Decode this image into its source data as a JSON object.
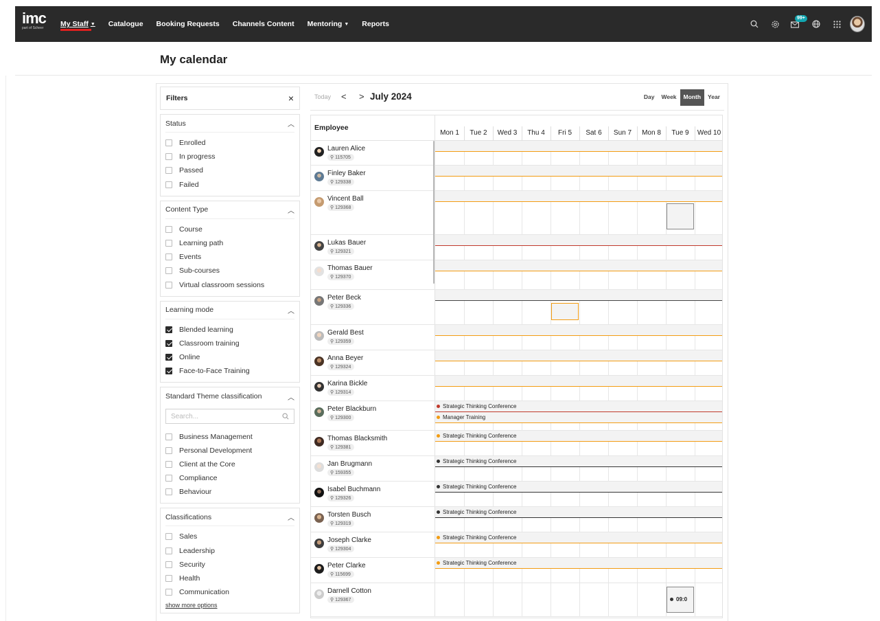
{
  "header": {
    "logo_text": "imc",
    "logo_sub": "part of Scheer",
    "nav": [
      {
        "label": "My Staff",
        "caret": true,
        "active": true
      },
      {
        "label": "Catalogue",
        "caret": false
      },
      {
        "label": "Booking Requests",
        "caret": false
      },
      {
        "label": "Channels Content",
        "caret": false
      },
      {
        "label": "Mentoring",
        "caret": true
      },
      {
        "label": "Reports",
        "caret": false
      }
    ],
    "badge": "99+"
  },
  "page": {
    "title": "My calendar"
  },
  "filters": {
    "title": "Filters",
    "close_glyph": "×",
    "status": {
      "title": "Status",
      "options": [
        {
          "label": "Enrolled",
          "checked": false
        },
        {
          "label": "In progress",
          "checked": false
        },
        {
          "label": "Passed",
          "checked": false
        },
        {
          "label": "Failed",
          "checked": false
        }
      ]
    },
    "content_type": {
      "title": "Content Type",
      "options": [
        {
          "label": "Course",
          "checked": false
        },
        {
          "label": "Learning path",
          "checked": false
        },
        {
          "label": "Events",
          "checked": false
        },
        {
          "label": "Sub-courses",
          "checked": false
        },
        {
          "label": "Virtual classroom sessions",
          "checked": false
        }
      ]
    },
    "learning_mode": {
      "title": "Learning mode",
      "options": [
        {
          "label": "Blended learning",
          "checked": true
        },
        {
          "label": "Classroom training",
          "checked": true
        },
        {
          "label": "Online",
          "checked": true
        },
        {
          "label": "Face-to-Face Training",
          "checked": true
        }
      ]
    },
    "theme": {
      "title": "Standard Theme classification",
      "search_placeholder": "Search...",
      "options": [
        {
          "label": "Business Management",
          "checked": false
        },
        {
          "label": "Personal Development",
          "checked": false
        },
        {
          "label": "Client at the Core",
          "checked": false
        },
        {
          "label": "Compliance",
          "checked": false
        },
        {
          "label": "Behaviour",
          "checked": false
        }
      ]
    },
    "classifications": {
      "title": "Classifications",
      "options": [
        {
          "label": "Sales",
          "checked": false
        },
        {
          "label": "Leadership",
          "checked": false
        },
        {
          "label": "Security",
          "checked": false
        },
        {
          "label": "Health",
          "checked": false
        },
        {
          "label": "Communication",
          "checked": false
        }
      ]
    },
    "show_more": "show more options"
  },
  "calendar": {
    "today": "Today",
    "prev": "<",
    "next": ">",
    "month_label": "July 2024",
    "views": [
      {
        "label": "Day"
      },
      {
        "label": "Week"
      },
      {
        "label": "Month",
        "selected": true
      },
      {
        "label": "Year"
      }
    ],
    "employee_header": "Employee",
    "days": [
      "Mon 1",
      "Tue 2",
      "Wed 3",
      "Thu 4",
      "Fri 5",
      "Sat 6",
      "Sun 7",
      "Mon 8",
      "Tue 9",
      "Wed 10"
    ],
    "colors": {
      "orange": "#f39c12",
      "red": "#c0392b",
      "dark": "#333333"
    },
    "employees": [
      {
        "name": "Lauren Alice",
        "id": "115705"
      },
      {
        "name": "Finley Baker",
        "id": "129338"
      },
      {
        "name": "Vincent Ball",
        "id": "129368"
      },
      {
        "name": "Lukas Bauer",
        "id": "129321"
      },
      {
        "name": "Thomas Bauer",
        "id": "129370"
      },
      {
        "name": "Peter Beck",
        "id": "129336"
      },
      {
        "name": "Gerald Best",
        "id": "129359"
      },
      {
        "name": "Anna Beyer",
        "id": "129324"
      },
      {
        "name": "Karina Bickle",
        "id": "129314"
      },
      {
        "name": "Peter Blackburn",
        "id": "129300",
        "events": [
          {
            "label": "Strategic Thinking Conference",
            "color": "#c0392b"
          },
          {
            "label": "Manager Training",
            "color": "#f39c12"
          }
        ]
      },
      {
        "name": "Thomas Blacksmith",
        "id": "129381",
        "events": [
          {
            "label": "Strategic Thinking Conference",
            "color": "#f39c12"
          }
        ]
      },
      {
        "name": "Jan Brugmann",
        "id": "159355",
        "events": [
          {
            "label": "Strategic Thinking Conference",
            "color": "#333333"
          }
        ]
      },
      {
        "name": "Isabel Buchmann",
        "id": "129326",
        "events": [
          {
            "label": "Strategic Thinking Conference",
            "color": "#333333"
          }
        ]
      },
      {
        "name": "Torsten Busch",
        "id": "129319",
        "events": [
          {
            "label": "Strategic Thinking Conference",
            "color": "#333333"
          }
        ]
      },
      {
        "name": "Joseph Clarke",
        "id": "129304",
        "events": [
          {
            "label": "Strategic Thinking Conference",
            "color": "#f39c12"
          }
        ]
      },
      {
        "name": "Peter Clarke",
        "id": "115699",
        "events": [
          {
            "label": "Strategic Thinking Conference",
            "color": "#f39c12"
          }
        ]
      },
      {
        "name": "Darnell Cotton",
        "id": "129367",
        "events": [
          {
            "label": "09:0",
            "color": "#333333",
            "day": "Tue 9"
          }
        ]
      }
    ]
  }
}
